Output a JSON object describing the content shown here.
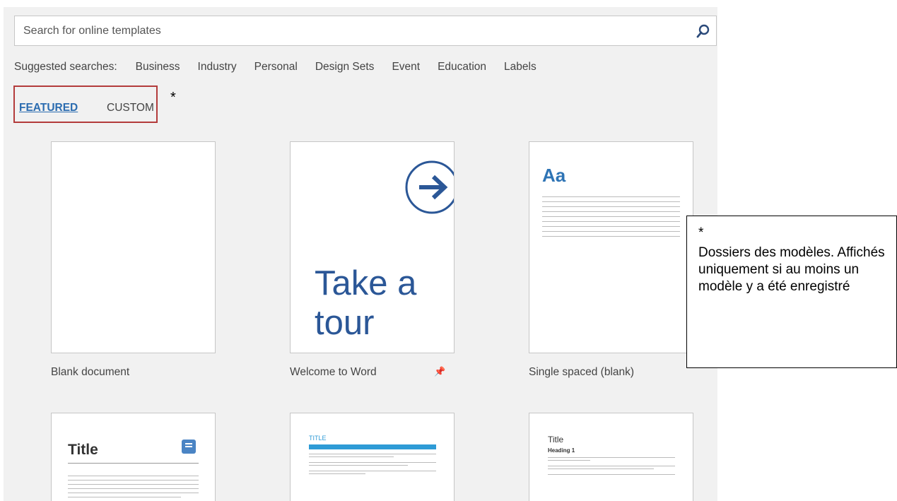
{
  "search": {
    "placeholder": "Search for online templates",
    "icon": "search-icon"
  },
  "suggested": {
    "label": "Suggested searches:",
    "items": [
      "Business",
      "Industry",
      "Personal",
      "Design Sets",
      "Event",
      "Education",
      "Labels"
    ]
  },
  "tabs": {
    "featured": "FEATURED",
    "custom": "CUSTOM"
  },
  "asterisk": "*",
  "templates": [
    {
      "caption": "Blank document"
    },
    {
      "caption": "Welcome to Word",
      "tour_line1": "Take a",
      "tour_line2": "tour",
      "pin_icon": "pin-icon"
    },
    {
      "caption": "Single spaced (blank)",
      "heading": "Aa"
    },
    {
      "title": "Title"
    },
    {
      "title": "TITLE"
    },
    {
      "title": "Title",
      "heading": "Heading 1"
    }
  ],
  "note": {
    "star": "*",
    "text": "Dossiers des modèles. Affichés uniquement si au moins un modèle y a été enregistré"
  },
  "colors": {
    "accent": "#2b6cb0",
    "highlight_border": "#b33b3b",
    "panel_bg": "#f1f1f1"
  }
}
